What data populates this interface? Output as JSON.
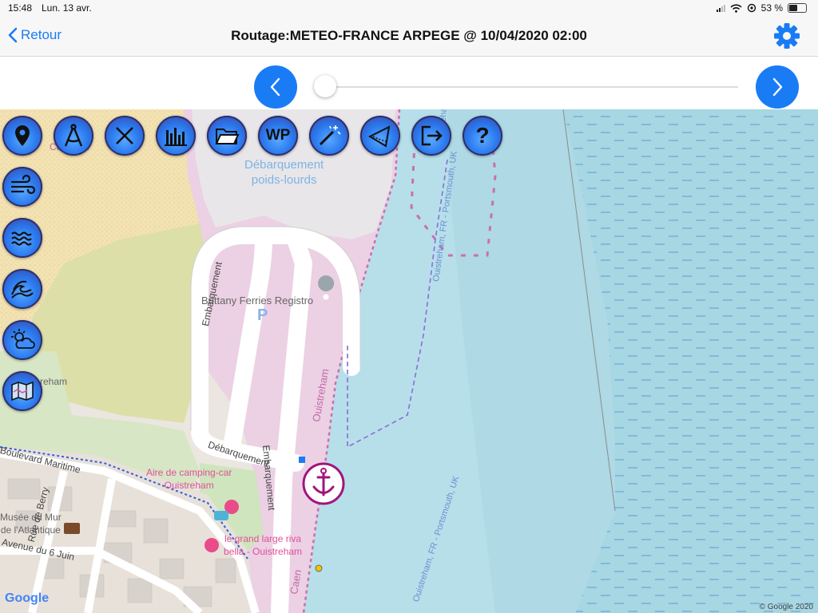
{
  "status_bar": {
    "time": "15:48",
    "date": "Lun. 13 avr.",
    "battery": "53 %"
  },
  "nav": {
    "back_label": "Retour",
    "title": "Routage:METEO-FRANCE ARPEGE @ 10/04/2020 02:00"
  },
  "map": {
    "labels": {
      "debarquement_pl": "Débarquement\npoids-lourds",
      "brittany": "Brittany Ferries Registro",
      "parking": "P",
      "embarquement_1": "Embarquement",
      "embarquement_2": "Embarquement",
      "debarquement": "Débarquement",
      "ouistreham": "Ouistreham",
      "caen": "Caen",
      "camping": "Aire de camping-car\nOuistreham",
      "grand_large": "le grand large riva\nbella - Ouistreham",
      "musee": "Musée du Mur\nde l'Atlantique",
      "boulevard": "Boulevard Maritime",
      "berry": "Rue de Berry",
      "avenue": "Avenue du 6 Juin",
      "route_1": "Ouistreham, FR - Portsmouth, UK",
      "route_2": "Ouistreham, FR - Portsmouth, UK",
      "route_3": "Ouistreham, FR - Portsmouth, UK",
      "calvados": "Calvados",
      "reham": "reham",
      "google": "Google",
      "copyright": "© Google 2020"
    }
  },
  "toolbar": {
    "items": [
      "map-pin",
      "compass-divider",
      "close-x",
      "bar-chart",
      "folder",
      "WP",
      "magic-wand",
      "wind-cone",
      "exit",
      "help"
    ],
    "wp_label": "WP",
    "help_label": "?"
  },
  "side_tools": {
    "items": [
      "wind",
      "waves",
      "swell",
      "weather",
      "map"
    ]
  },
  "colors": {
    "accent": "#1a7cf5",
    "sea": "#a6d7e3",
    "channel": "#b9e0ea",
    "pink_zone": "#eccde4",
    "route": "#8a6dd8"
  }
}
